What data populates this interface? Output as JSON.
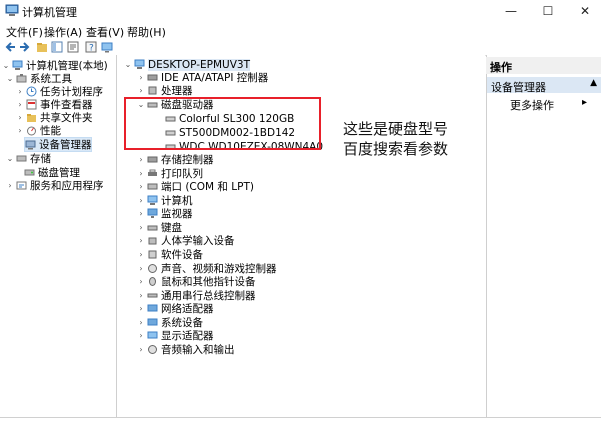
{
  "window": {
    "title": "计算机管理",
    "minimize": "—",
    "maximize": "☐",
    "close": "✕"
  },
  "menu": [
    "文件(F)",
    "操作(A)",
    "查看(V)",
    "帮助(H)"
  ],
  "left_tree": {
    "root": "计算机管理(本地)",
    "system_tools": "系统工具",
    "items": [
      "任务计划程序",
      "事件查看器",
      "共享文件夹",
      "性能",
      "设备管理器"
    ],
    "storage": "存储",
    "disk_mgmt": "磁盘管理",
    "services": "服务和应用程序"
  },
  "device_tree": {
    "computer": "DESKTOP-EPMUV3T",
    "categories_top": [
      "IDE ATA/ATAPI 控制器",
      "处理器"
    ],
    "disk_category": "磁盘驱动器",
    "disks": [
      "Colorful SL300 120GB",
      "ST500DM002-1BD142",
      "WDC WD10EZEX-08WN4A0"
    ],
    "categories_bottom": [
      "存储控制器",
      "打印队列",
      "端口 (COM 和 LPT)",
      "计算机",
      "监视器",
      "键盘",
      "人体学输入设备",
      "软件设备",
      "声音、视频和游戏控制器",
      "鼠标和其他指针设备",
      "通用串行总线控制器",
      "网络适配器",
      "系统设备",
      "显示适配器",
      "音频输入和输出"
    ]
  },
  "actions": {
    "header": "操作",
    "section": "设备管理器",
    "more": "更多操作"
  },
  "annotation": {
    "line1": "这些是硬盘型号",
    "line2": "百度搜索看参数"
  },
  "colors": {
    "highlight": "#d9e8f7",
    "annotation_box": "#e8202a",
    "actions_section": "#dbe7f4"
  }
}
